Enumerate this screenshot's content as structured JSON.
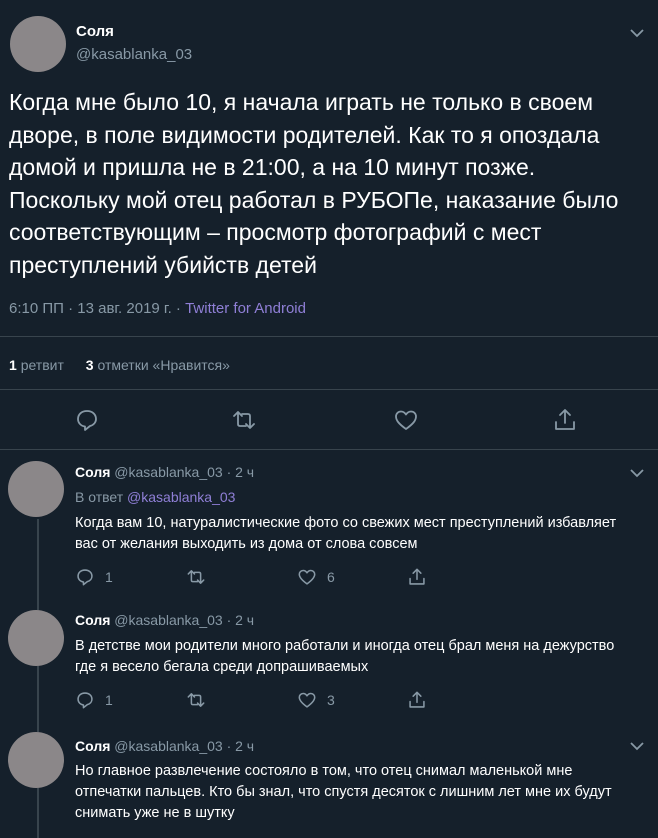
{
  "main_tweet": {
    "author_name": "Соля",
    "handle": "@kasablanka_03",
    "text": "Когда мне было 10, я начала играть не только в своем дворе, в поле видимости родителей. Как то я опоздала домой и пришла не в 21:00, а на 10 минут позже. Поскольку мой отец работал в РУБОПе, наказание было соответствующим – просмотр фотографий с мест преступлений убийств детей",
    "timestamp": "6:10 ПП · 13 авг. 2019 г. · ",
    "source": "Twitter for Android",
    "retweets_count": "1",
    "retweets_label": "ретвит",
    "likes_count": "3",
    "likes_label": "отметки «Нравится»"
  },
  "replies": [
    {
      "author_name": "Соля",
      "handle_time": "@kasablanka_03 · 2 ч",
      "in_reply_prefix": "В ответ ",
      "in_reply_handle": "@kasablanka_03",
      "text": "Когда вам 10, натуралистические фото со свежих мест преступлений избавляет вас от желания выходить из дома от слова совсем",
      "reply_count": "1",
      "retweet_count": "",
      "like_count": "6"
    },
    {
      "author_name": "Соля",
      "handle_time": "@kasablanka_03 · 2 ч",
      "text": "В детстве мои родители много работали и иногда отец брал меня на дежурство где я весело бегала среди допрашиваемых",
      "reply_count": "1",
      "retweet_count": "",
      "like_count": "3"
    },
    {
      "author_name": "Соля",
      "handle_time": "@kasablanka_03 · 2 ч",
      "text": "Но главное развлечение состояло в том, что отец снимал маленькой мне отпечатки пальцев. Кто бы знал, что спустя десяток с лишним лет мне их будут снимать уже не в шутку"
    }
  ],
  "icons": [
    "chevron-down-icon",
    "reply-icon",
    "retweet-icon",
    "like-icon",
    "share-icon"
  ],
  "colors": {
    "background": "#15202b",
    "text": "#ffffff",
    "muted": "#8899a6",
    "link": "#8f7fd6",
    "divider": "#38444d",
    "avatar": "#8b8789"
  }
}
